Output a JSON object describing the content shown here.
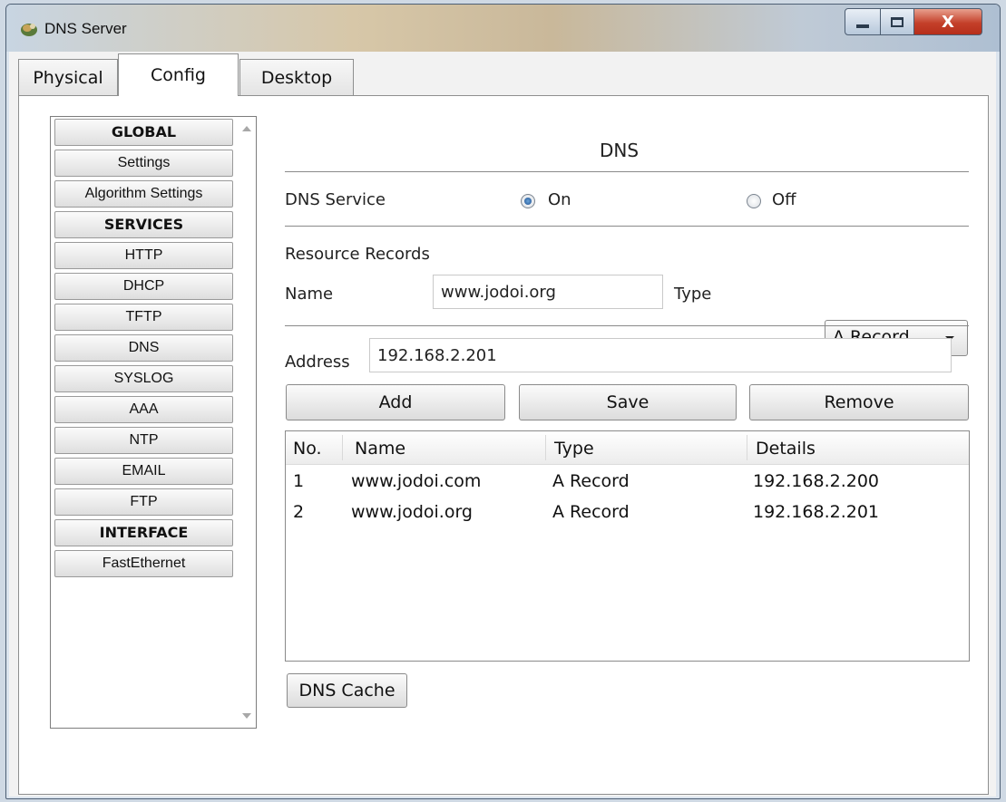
{
  "window": {
    "title": "DNS Server",
    "close_glyph": "X"
  },
  "tabs": [
    "Physical",
    "Config",
    "Desktop"
  ],
  "sidebar": {
    "items": [
      {
        "label": "GLOBAL",
        "header": true
      },
      {
        "label": "Settings"
      },
      {
        "label": "Algorithm Settings"
      },
      {
        "label": "SERVICES",
        "header": true
      },
      {
        "label": "HTTP"
      },
      {
        "label": "DHCP"
      },
      {
        "label": "TFTP"
      },
      {
        "label": "DNS"
      },
      {
        "label": "SYSLOG"
      },
      {
        "label": "AAA"
      },
      {
        "label": "NTP"
      },
      {
        "label": "EMAIL"
      },
      {
        "label": "FTP"
      },
      {
        "label": "INTERFACE",
        "header": true
      },
      {
        "label": "FastEthernet"
      }
    ]
  },
  "dns": {
    "title": "DNS",
    "service_label": "DNS Service",
    "on_label": "On",
    "off_label": "Off",
    "service_state": "On",
    "resource_records_label": "Resource Records",
    "name_label": "Name",
    "name_value": "www.jodoi.org",
    "type_label": "Type",
    "type_value": "A Record",
    "address_label": "Address",
    "address_value": "192.168.2.201",
    "add_label": "Add",
    "save_label": "Save",
    "remove_label": "Remove",
    "cache_label": "DNS Cache",
    "table": {
      "headers": [
        "No.",
        "Name",
        "Type",
        "Details"
      ],
      "rows": [
        [
          "1",
          "www.jodoi.com",
          "A Record",
          "192.168.2.200"
        ],
        [
          "2",
          "www.jodoi.org",
          "A Record",
          "192.168.2.201"
        ]
      ]
    }
  },
  "icons": {
    "app": "dns-server-app-icon",
    "minimize": "minimize-icon",
    "maximize": "maximize-icon",
    "close": "close-icon",
    "dropdown": "chevron-down-icon"
  },
  "colors": {
    "close_button": "#c4402a",
    "radio_selected": "#1d4f8f"
  }
}
